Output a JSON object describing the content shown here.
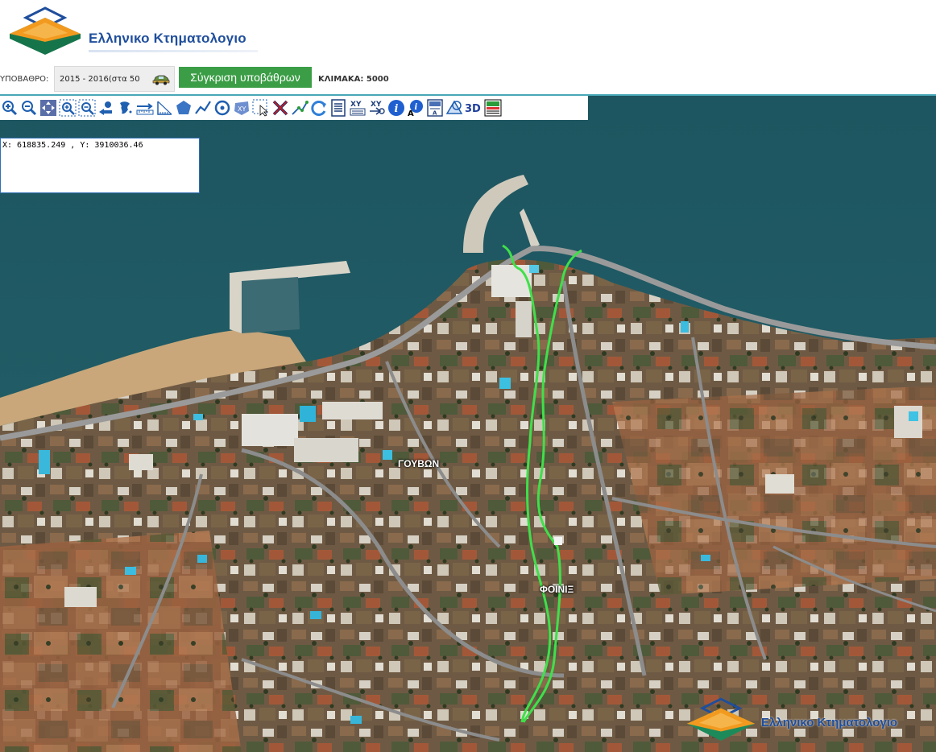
{
  "header": {
    "logo_text": "Ελληνικο Κτηματολογιο"
  },
  "basemap": {
    "label": "ΥΠΟΒΑΘΡΟ:",
    "selected": "2015 - 2016(στα 50",
    "compare_button": "Σύγκριση υποβάθρων",
    "scale": "ΚΛΙΜΑΚΑ: 5000"
  },
  "toolbar": {
    "tools": [
      "zoom-in-icon",
      "zoom-out-icon",
      "pan-icon",
      "zoom-box-in-icon",
      "zoom-box-out-icon",
      "previous-extent-icon",
      "full-extent-icon",
      "measure-distance-icon",
      "measure-angle-icon",
      "draw-polygon-icon",
      "draw-line-icon",
      "draw-circle-icon",
      "parcel-select-icon",
      "select-arrow-icon",
      "clear-icon",
      "edit-vertex-icon",
      "refresh-icon",
      "legend-list-icon",
      "xy-coordinate-icon",
      "goto-xy-icon",
      "info-icon",
      "info-text-icon",
      "print-icon",
      "layers-icon",
      "3d-view-icon",
      "basemap-gallery-icon"
    ],
    "label_3d": "3D",
    "label_xy": "XY"
  },
  "coordinates": {
    "text": "X: 618835.249 , Y: 3910036.46"
  },
  "map_labels": {
    "place_1": "ΓΟΥΒΩΝ",
    "place_2": "ΦΟΙΝΙΞ"
  },
  "watermark": {
    "text": "Ελληνικο Κτηματολογιο"
  },
  "colors": {
    "brand_blue": "#1f4e9c",
    "button_green": "#3b9e46",
    "trace_green": "#3fe04a",
    "sea": "#1f5a66"
  }
}
